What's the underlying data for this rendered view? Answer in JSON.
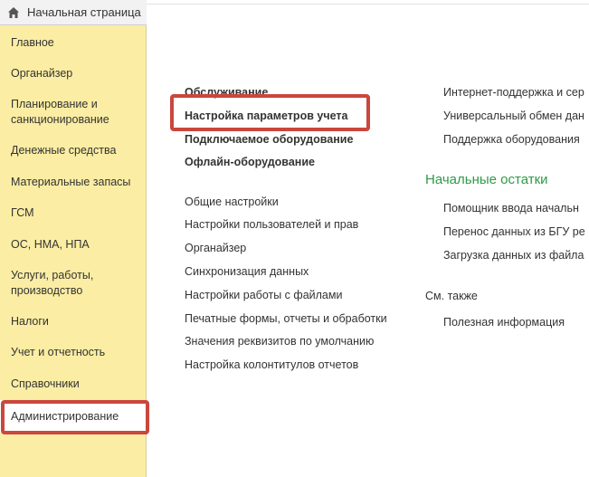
{
  "colors": {
    "sidebar_bg": "#fbeda3",
    "section_title": "#2e9a47",
    "highlight": "#c9473d"
  },
  "home_tab": {
    "label": "Начальная страница",
    "icon": "home-icon"
  },
  "sidebar": {
    "items": [
      {
        "label": "Главное"
      },
      {
        "label": "Органайзер"
      },
      {
        "label": "Планирование и санкционирование"
      },
      {
        "label": "Денежные средства"
      },
      {
        "label": "Материальные запасы"
      },
      {
        "label": "ГСМ"
      },
      {
        "label": "ОС, НМА, НПА"
      },
      {
        "label": "Услуги, работы, производство"
      },
      {
        "label": "Налоги"
      },
      {
        "label": "Учет и отчетность"
      },
      {
        "label": "Справочники"
      },
      {
        "label": "Администрирование",
        "active": true
      }
    ]
  },
  "main": {
    "col1_bold": [
      "Обслуживание",
      "Настройка параметров учета",
      "Подключаемое оборудование",
      "Офлайн-оборудование"
    ],
    "col1_links": [
      "Общие настройки",
      "Настройки пользователей и прав",
      "Органайзер",
      "Синхронизация данных",
      "Настройки работы с файлами",
      "Печатные формы, отчеты и обработки",
      "Значения реквизитов по умолчанию",
      "Настройка колонтитулов отчетов"
    ],
    "col2_links": [
      "Интернет-поддержка и сер",
      "Универсальный обмен дан",
      "Поддержка оборудования"
    ],
    "section_title": "Начальные остатки",
    "col2_section_links": [
      "Помощник ввода начальн",
      "Перенос данных из БГУ ре",
      "Загрузка данных из файла"
    ],
    "see_also_label": "См. также",
    "see_also_links": [
      "Полезная информация"
    ]
  }
}
